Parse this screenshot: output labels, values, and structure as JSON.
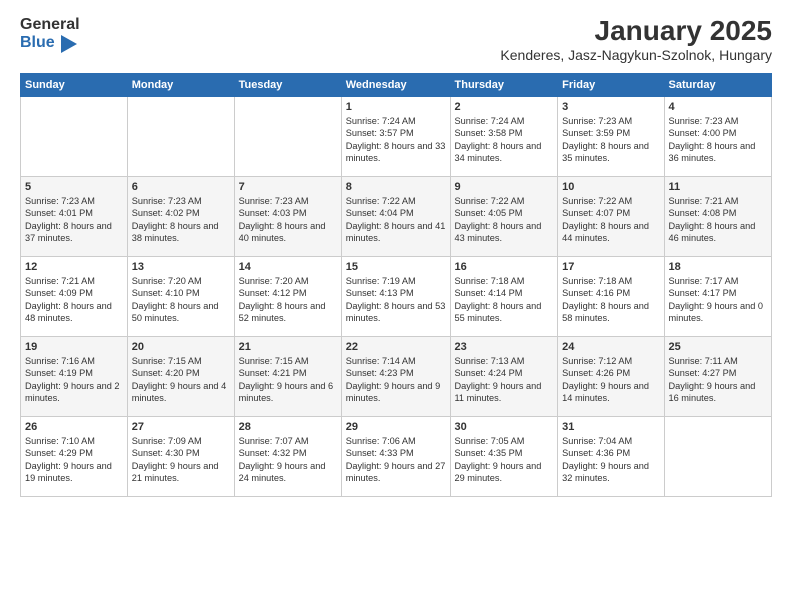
{
  "header": {
    "logo_general": "General",
    "logo_blue": "Blue",
    "title": "January 2025",
    "subtitle": "Kenderes, Jasz-Nagykun-Szolnok, Hungary"
  },
  "calendar": {
    "days_of_week": [
      "Sunday",
      "Monday",
      "Tuesday",
      "Wednesday",
      "Thursday",
      "Friday",
      "Saturday"
    ],
    "weeks": [
      [
        {
          "day": "",
          "info": ""
        },
        {
          "day": "",
          "info": ""
        },
        {
          "day": "",
          "info": ""
        },
        {
          "day": "1",
          "info": "Sunrise: 7:24 AM\nSunset: 3:57 PM\nDaylight: 8 hours\nand 33 minutes."
        },
        {
          "day": "2",
          "info": "Sunrise: 7:24 AM\nSunset: 3:58 PM\nDaylight: 8 hours\nand 34 minutes."
        },
        {
          "day": "3",
          "info": "Sunrise: 7:23 AM\nSunset: 3:59 PM\nDaylight: 8 hours\nand 35 minutes."
        },
        {
          "day": "4",
          "info": "Sunrise: 7:23 AM\nSunset: 4:00 PM\nDaylight: 8 hours\nand 36 minutes."
        }
      ],
      [
        {
          "day": "5",
          "info": "Sunrise: 7:23 AM\nSunset: 4:01 PM\nDaylight: 8 hours\nand 37 minutes."
        },
        {
          "day": "6",
          "info": "Sunrise: 7:23 AM\nSunset: 4:02 PM\nDaylight: 8 hours\nand 38 minutes."
        },
        {
          "day": "7",
          "info": "Sunrise: 7:23 AM\nSunset: 4:03 PM\nDaylight: 8 hours\nand 40 minutes."
        },
        {
          "day": "8",
          "info": "Sunrise: 7:22 AM\nSunset: 4:04 PM\nDaylight: 8 hours\nand 41 minutes."
        },
        {
          "day": "9",
          "info": "Sunrise: 7:22 AM\nSunset: 4:05 PM\nDaylight: 8 hours\nand 43 minutes."
        },
        {
          "day": "10",
          "info": "Sunrise: 7:22 AM\nSunset: 4:07 PM\nDaylight: 8 hours\nand 44 minutes."
        },
        {
          "day": "11",
          "info": "Sunrise: 7:21 AM\nSunset: 4:08 PM\nDaylight: 8 hours\nand 46 minutes."
        }
      ],
      [
        {
          "day": "12",
          "info": "Sunrise: 7:21 AM\nSunset: 4:09 PM\nDaylight: 8 hours\nand 48 minutes."
        },
        {
          "day": "13",
          "info": "Sunrise: 7:20 AM\nSunset: 4:10 PM\nDaylight: 8 hours\nand 50 minutes."
        },
        {
          "day": "14",
          "info": "Sunrise: 7:20 AM\nSunset: 4:12 PM\nDaylight: 8 hours\nand 52 minutes."
        },
        {
          "day": "15",
          "info": "Sunrise: 7:19 AM\nSunset: 4:13 PM\nDaylight: 8 hours\nand 53 minutes."
        },
        {
          "day": "16",
          "info": "Sunrise: 7:18 AM\nSunset: 4:14 PM\nDaylight: 8 hours\nand 55 minutes."
        },
        {
          "day": "17",
          "info": "Sunrise: 7:18 AM\nSunset: 4:16 PM\nDaylight: 8 hours\nand 58 minutes."
        },
        {
          "day": "18",
          "info": "Sunrise: 7:17 AM\nSunset: 4:17 PM\nDaylight: 9 hours\nand 0 minutes."
        }
      ],
      [
        {
          "day": "19",
          "info": "Sunrise: 7:16 AM\nSunset: 4:19 PM\nDaylight: 9 hours\nand 2 minutes."
        },
        {
          "day": "20",
          "info": "Sunrise: 7:15 AM\nSunset: 4:20 PM\nDaylight: 9 hours\nand 4 minutes."
        },
        {
          "day": "21",
          "info": "Sunrise: 7:15 AM\nSunset: 4:21 PM\nDaylight: 9 hours\nand 6 minutes."
        },
        {
          "day": "22",
          "info": "Sunrise: 7:14 AM\nSunset: 4:23 PM\nDaylight: 9 hours\nand 9 minutes."
        },
        {
          "day": "23",
          "info": "Sunrise: 7:13 AM\nSunset: 4:24 PM\nDaylight: 9 hours\nand 11 minutes."
        },
        {
          "day": "24",
          "info": "Sunrise: 7:12 AM\nSunset: 4:26 PM\nDaylight: 9 hours\nand 14 minutes."
        },
        {
          "day": "25",
          "info": "Sunrise: 7:11 AM\nSunset: 4:27 PM\nDaylight: 9 hours\nand 16 minutes."
        }
      ],
      [
        {
          "day": "26",
          "info": "Sunrise: 7:10 AM\nSunset: 4:29 PM\nDaylight: 9 hours\nand 19 minutes."
        },
        {
          "day": "27",
          "info": "Sunrise: 7:09 AM\nSunset: 4:30 PM\nDaylight: 9 hours\nand 21 minutes."
        },
        {
          "day": "28",
          "info": "Sunrise: 7:07 AM\nSunset: 4:32 PM\nDaylight: 9 hours\nand 24 minutes."
        },
        {
          "day": "29",
          "info": "Sunrise: 7:06 AM\nSunset: 4:33 PM\nDaylight: 9 hours\nand 27 minutes."
        },
        {
          "day": "30",
          "info": "Sunrise: 7:05 AM\nSunset: 4:35 PM\nDaylight: 9 hours\nand 29 minutes."
        },
        {
          "day": "31",
          "info": "Sunrise: 7:04 AM\nSunset: 4:36 PM\nDaylight: 9 hours\nand 32 minutes."
        },
        {
          "day": "",
          "info": ""
        }
      ]
    ]
  }
}
